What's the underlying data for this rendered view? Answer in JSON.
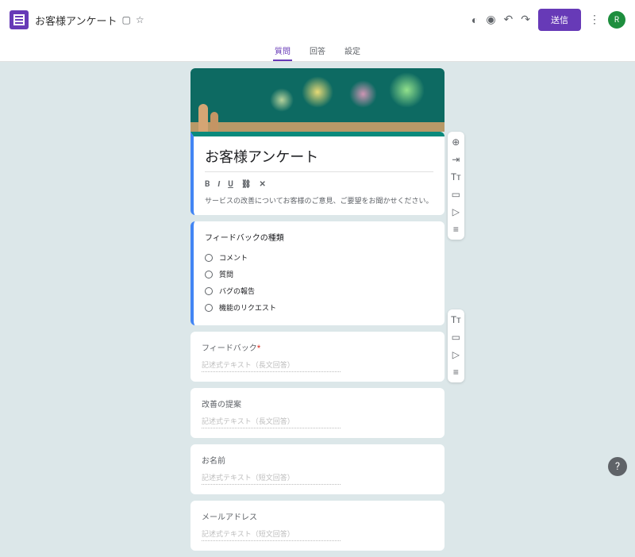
{
  "header": {
    "doc_title": "お客様アンケート",
    "send_label": "送信",
    "avatar_letter": "R"
  },
  "tabs": {
    "questions": "質問",
    "responses": "回答",
    "settings": "設定"
  },
  "form": {
    "title": "お客様アンケート",
    "description": "サービスの改善についてお客様のご意見、ご要望をお聞かせください。"
  },
  "q1": {
    "title": "フィードバックの種類",
    "options": [
      "コメント",
      "質問",
      "バグの報告",
      "機能のリクエスト"
    ]
  },
  "q2": {
    "title": "フィードバック",
    "required_mark": "*",
    "hint": "記述式テキスト（長文回答）"
  },
  "q3": {
    "title": "改善の提案",
    "hint": "記述式テキスト（長文回答）"
  },
  "q4": {
    "title": "お名前",
    "hint": "記述式テキスト（短文回答）"
  },
  "q5": {
    "title": "メールアドレス",
    "hint": "記述式テキスト（短文回答）"
  },
  "toolbar": {
    "bold": "B",
    "italic": "I",
    "underline": "U",
    "link": "⛓",
    "clear": "✕"
  }
}
